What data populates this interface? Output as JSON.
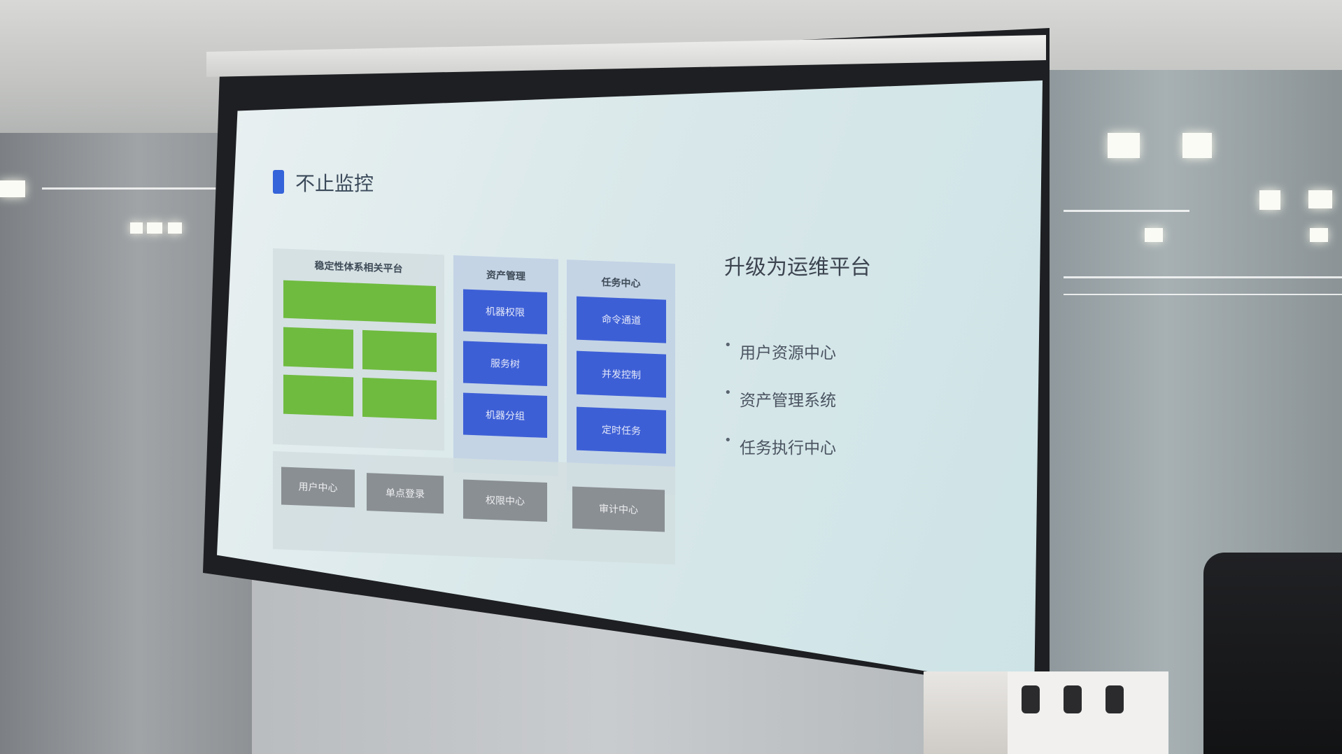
{
  "slide": {
    "title": "不止监控",
    "architecture": {
      "col1_header": "稳定性体系相关平台",
      "col2_header": "资产管理",
      "col3_header": "任务中心",
      "green_tiles": [
        "",
        "",
        "",
        "",
        ""
      ],
      "blue_tiles_col2": [
        "机器权限",
        "服务树",
        "机器分组"
      ],
      "blue_tiles_col3": [
        "命令通道",
        "并发控制",
        "定时任务"
      ],
      "gray_tiles": [
        "用户中心",
        "单点登录",
        "权限中心",
        "审计中心"
      ]
    },
    "upgrade_heading": "升级为运维平台",
    "bullets": [
      "用户资源中心",
      "资产管理系统",
      "任务执行中心"
    ]
  },
  "colors": {
    "green": "#6fbb3f",
    "blue": "#3d5fd6",
    "gray": "#8a8f94",
    "title_mark": "#3563d9"
  }
}
